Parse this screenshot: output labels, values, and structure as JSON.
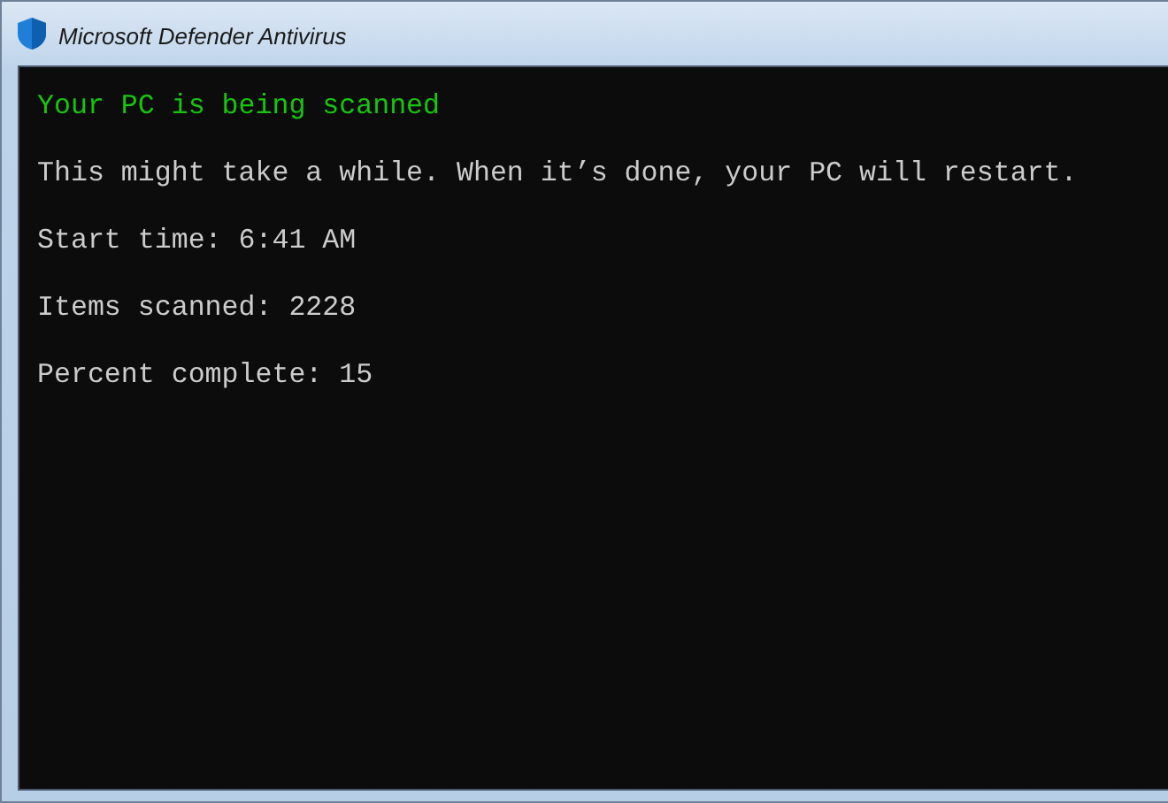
{
  "window": {
    "title": "Microsoft Defender Antivirus"
  },
  "console": {
    "lines": [
      {
        "kind": "status",
        "text": "Your PC is being scanned"
      },
      {
        "kind": "text",
        "text": "This might take a while. When it’s done, your PC will restart."
      },
      {
        "kind": "text",
        "text": "Start time: 6:41 AM"
      },
      {
        "kind": "text",
        "text": "Items scanned: 2228"
      },
      {
        "kind": "text",
        "text": "Percent complete: 15"
      }
    ]
  }
}
